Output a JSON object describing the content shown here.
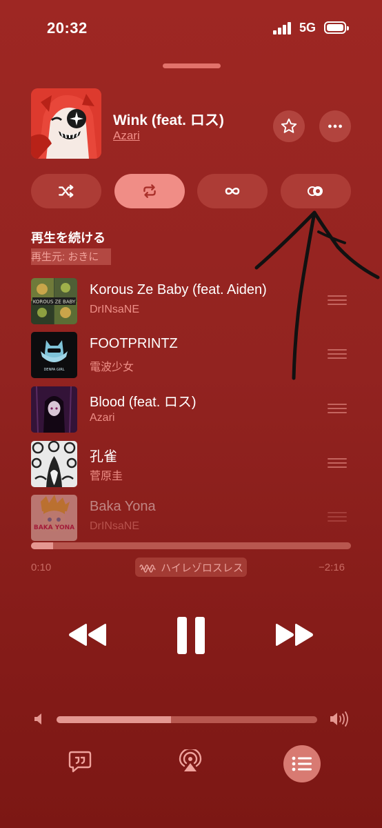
{
  "status_bar": {
    "time": "20:32",
    "network": "5G"
  },
  "now_playing": {
    "title": "Wink (feat. ロス)",
    "artist": "Azari"
  },
  "modes": {
    "shuffle": {
      "icon": "shuffle-icon",
      "active": false
    },
    "repeat": {
      "icon": "repeat-icon",
      "active": true
    },
    "autoplay": {
      "icon": "infinity-icon",
      "active": false
    },
    "crossfade": {
      "icon": "toggle-icon",
      "active": false
    }
  },
  "queue": {
    "heading": "再生を続ける",
    "source": "再生元: おきに",
    "items": [
      {
        "title": "Korous Ze Baby (feat. Aiden)",
        "artist": "DrINsaNE",
        "art_text": "KOROUS ZE BABY"
      },
      {
        "title": "FOOTPRINTZ",
        "artist": "電波少女",
        "art_text": "DENPA GIRL"
      },
      {
        "title": "Blood (feat. ロス)",
        "artist": "Azari"
      },
      {
        "title": "孔雀",
        "artist": "菅原圭"
      },
      {
        "title": "Baka Yona",
        "artist": "DrINsaNE",
        "art_text": "BAKA YONA"
      }
    ]
  },
  "playback": {
    "elapsed": "0:10",
    "remaining": "−2:16",
    "progress": 0.07,
    "quality": "ハイレゾロスレス"
  },
  "volume": {
    "level": 0.44
  },
  "colors": {
    "background": "#9e2723",
    "accent": "#f08d86",
    "secondary_text": "#ee8f87"
  }
}
